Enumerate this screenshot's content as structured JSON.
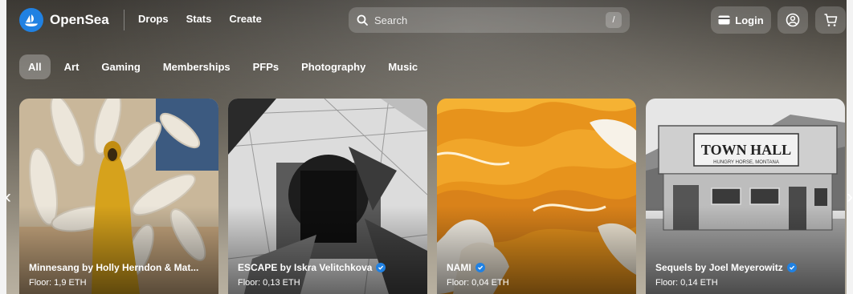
{
  "header": {
    "brand": "OpenSea",
    "nav": [
      "Drops",
      "Stats",
      "Create"
    ],
    "search_placeholder": "Search",
    "search_shortcut": "/",
    "login_label": "Login"
  },
  "categories": {
    "items": [
      "All",
      "Art",
      "Gaming",
      "Memberships",
      "PFPs",
      "Photography",
      "Music"
    ],
    "active": "All"
  },
  "collections": [
    {
      "title": "Minnesang by Holly Herndon & Mat...",
      "floor": "Floor: 1,9 ETH",
      "verified": false
    },
    {
      "title": "ESCAPE by Iskra Velitchkova",
      "floor": "Floor: 0,13 ETH",
      "verified": true
    },
    {
      "title": "NAMI",
      "floor": "Floor: 0,04 ETH",
      "verified": true
    },
    {
      "title": "Sequels by Joel Meyerowitz",
      "floor": "Floor: 0,14 ETH",
      "verified": true
    }
  ],
  "art_text": {
    "sign_main": "TOWN HALL",
    "sign_sub": "HUNGRY HORSE, MONTANA"
  },
  "colors": {
    "brand": "#2081e2",
    "verified": "#2081e2"
  },
  "icons": {
    "brand": "opensea-logo-icon",
    "search": "search-icon",
    "login": "wallet-icon",
    "account": "account-icon",
    "cart": "cart-icon",
    "prev": "chevron-left-icon",
    "next": "chevron-right-icon",
    "verified": "verified-badge-icon"
  }
}
